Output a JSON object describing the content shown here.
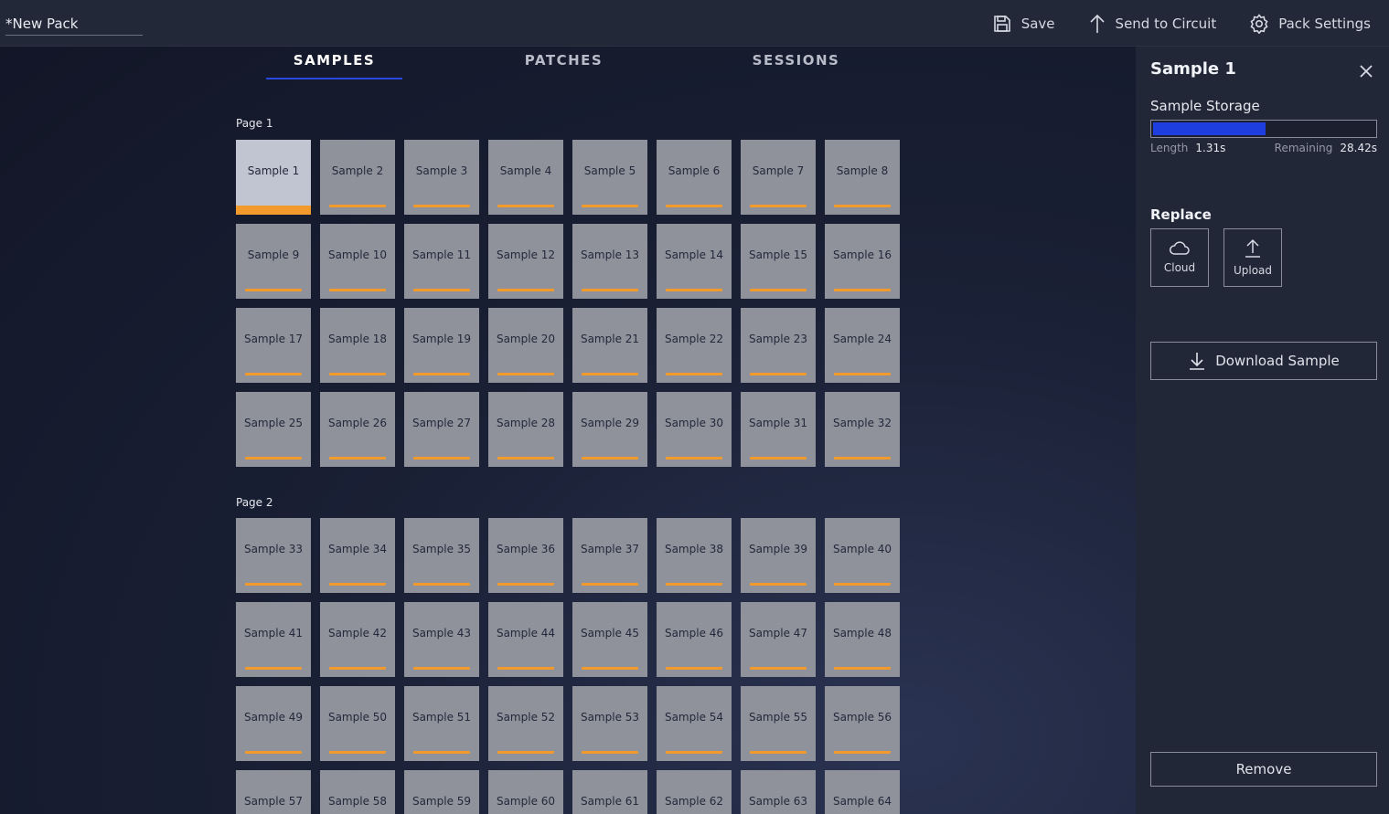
{
  "header": {
    "pack_name": "*New Pack",
    "save_label": "Save",
    "send_label": "Send to Circuit",
    "settings_label": "Pack Settings"
  },
  "tabs": [
    {
      "label": "SAMPLES",
      "active": true
    },
    {
      "label": "PATCHES",
      "active": false
    },
    {
      "label": "SESSIONS",
      "active": false
    }
  ],
  "pages": [
    {
      "label": "Page 1",
      "samples": [
        "Sample 1",
        "Sample 2",
        "Sample 3",
        "Sample 4",
        "Sample 5",
        "Sample 6",
        "Sample 7",
        "Sample 8",
        "Sample 9",
        "Sample 10",
        "Sample 11",
        "Sample 12",
        "Sample 13",
        "Sample 14",
        "Sample 15",
        "Sample 16",
        "Sample 17",
        "Sample 18",
        "Sample 19",
        "Sample 20",
        "Sample 21",
        "Sample 22",
        "Sample 23",
        "Sample 24",
        "Sample 25",
        "Sample 26",
        "Sample 27",
        "Sample 28",
        "Sample 29",
        "Sample 30",
        "Sample 31",
        "Sample 32"
      ]
    },
    {
      "label": "Page 2",
      "samples": [
        "Sample 33",
        "Sample 34",
        "Sample 35",
        "Sample 36",
        "Sample 37",
        "Sample 38",
        "Sample 39",
        "Sample 40",
        "Sample 41",
        "Sample 42",
        "Sample 43",
        "Sample 44",
        "Sample 45",
        "Sample 46",
        "Sample 47",
        "Sample 48",
        "Sample 49",
        "Sample 50",
        "Sample 51",
        "Sample 52",
        "Sample 53",
        "Sample 54",
        "Sample 55",
        "Sample 56",
        "Sample 57",
        "Sample 58",
        "Sample 59",
        "Sample 60",
        "Sample 61",
        "Sample 62",
        "Sample 63",
        "Sample 64"
      ]
    }
  ],
  "selected_sample": "Sample 1",
  "panel": {
    "title": "Sample 1",
    "storage_label": "Sample Storage",
    "storage_used_fraction": 0.51,
    "length_label": "Length",
    "length_value": "1.31s",
    "remaining_label": "Remaining",
    "remaining_value": "28.42s",
    "replace_label": "Replace",
    "cloud_label": "Cloud",
    "upload_label": "Upload",
    "download_label": "Download Sample",
    "remove_label": "Remove"
  },
  "colors": {
    "accent_blue": "#1e3ee0",
    "pad_bar_orange": "#f39a2c",
    "pad_grey": "#8f929b",
    "pad_selected": "#c1c5d2"
  },
  "icons": {
    "save": "floppy-disk-icon",
    "send": "arrow-up-icon",
    "settings": "gear-icon",
    "close": "close-icon",
    "cloud": "cloud-icon",
    "upload": "upload-icon",
    "download": "download-icon"
  }
}
